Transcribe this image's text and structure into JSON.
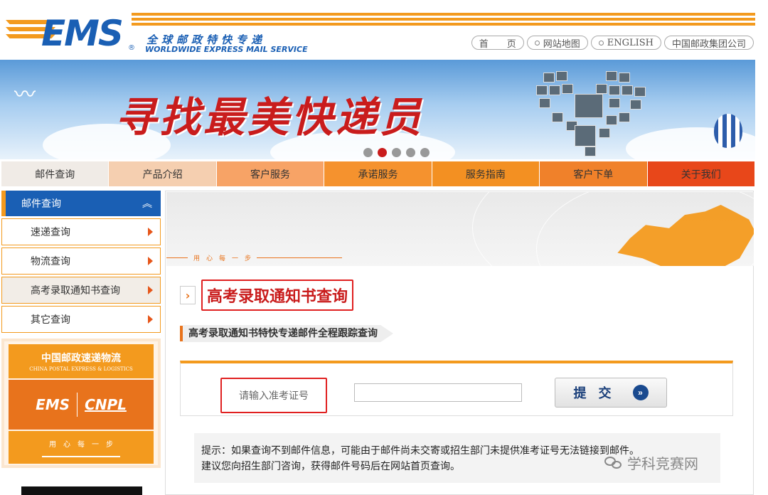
{
  "header": {
    "logo_text": "EMS",
    "logo_reg": "®",
    "tagline_cn": "全球邮政特快专递",
    "tagline_en": "WORLDWIDE EXPRESS MAIL SERVICE",
    "links": [
      "首　　页",
      "网站地图",
      "ENGLISH",
      "中国邮政集团公司"
    ]
  },
  "banner": {
    "title": "寻找最美快递员",
    "slide_count": 5,
    "active_slide": 2
  },
  "nav": {
    "items": [
      {
        "label": "邮件查询",
        "bg": "#f0ebe6"
      },
      {
        "label": "产品介绍",
        "bg": "#f5cfb0"
      },
      {
        "label": "客户服务",
        "bg": "#f7a366"
      },
      {
        "label": "承诺服务",
        "bg": "#f5922e"
      },
      {
        "label": "服务指南",
        "bg": "#f39022"
      },
      {
        "label": "客户下单",
        "bg": "#f0812a"
      },
      {
        "label": "关于我们",
        "bg": "#e8471a"
      }
    ]
  },
  "sidebar": {
    "heading": "邮件查询",
    "items": [
      {
        "label": "速递查询"
      },
      {
        "label": "物流查询"
      },
      {
        "label": "高考录取通知书查询",
        "active": true
      },
      {
        "label": "其它查询"
      }
    ],
    "promo": {
      "top_cn": "中国邮政速递物流",
      "top_en": "CHINA POSTAL EXPRESS & LOGISTICS",
      "mid_left": "EMS",
      "mid_right": "CNPL",
      "bottom_slogan": "用　心　每　一　步"
    }
  },
  "main": {
    "banner_slogan": "用　心　每　一　步",
    "page_title": "高考录取通知书查询",
    "sub_title": "高考录取通知书特快专递邮件全程跟踪查询",
    "form": {
      "label": "请输入准考证号",
      "input_value": "",
      "submit_label": "提 交",
      "submit_icon": "»"
    },
    "tip_lines": [
      "提示：如果查询不到邮件信息，可能由于邮件尚未交寄或招生部门未提供准考证号无法链接到邮件。",
      "建议您向招生部门咨询，获得邮件号码后在网站首页查询。"
    ]
  },
  "watermark": {
    "text": "学科竞赛网"
  }
}
